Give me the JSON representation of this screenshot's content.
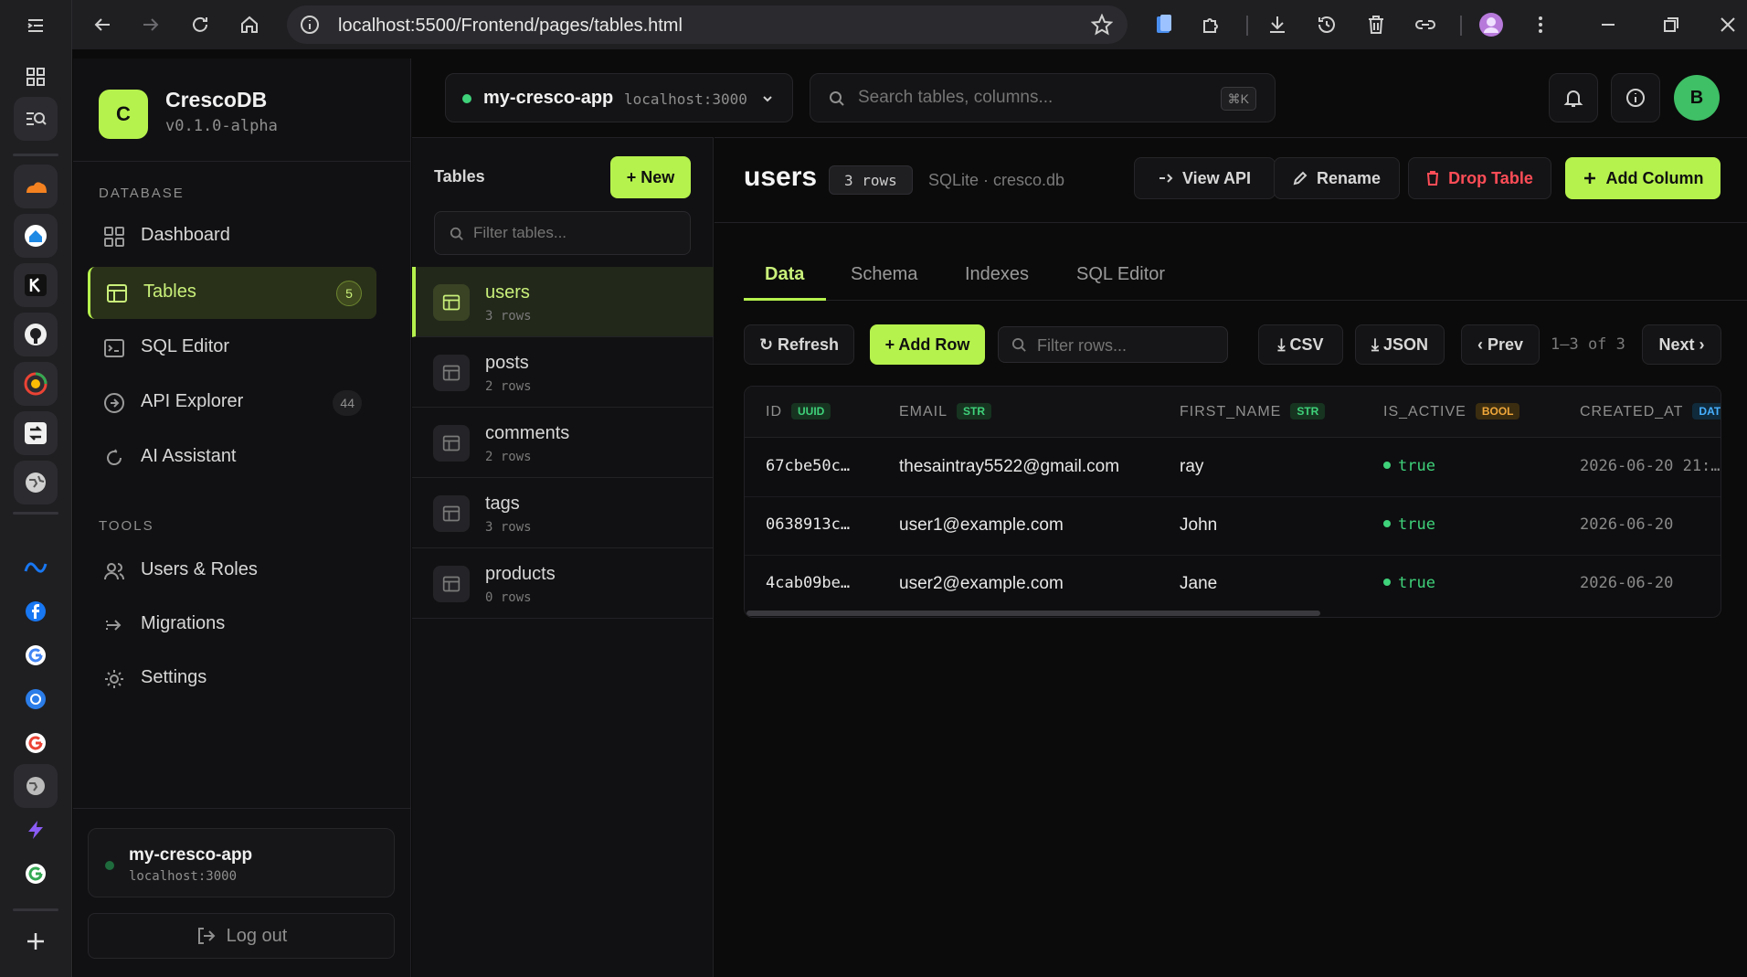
{
  "browser": {
    "url": "localhost:5500/Frontend/pages/tables.html"
  },
  "brand": {
    "logo_letter": "C",
    "name": "CrescoDB",
    "version": "v0.1.0-alpha"
  },
  "sidebar": {
    "database_section": "DATABASE",
    "tools_section": "TOOLS",
    "database_items": [
      {
        "label": "Dashboard",
        "icon": "dashboard-icon"
      },
      {
        "label": "Tables",
        "icon": "table-icon",
        "badge": "5"
      },
      {
        "label": "SQL Editor",
        "icon": "terminal-icon"
      },
      {
        "label": "API Explorer",
        "icon": "api-icon",
        "badge": "44"
      },
      {
        "label": "AI Assistant",
        "icon": "ai-icon"
      }
    ],
    "tools_items": [
      {
        "label": "Users & Roles",
        "icon": "users-icon"
      },
      {
        "label": "Migrations",
        "icon": "migrations-icon"
      },
      {
        "label": "Settings",
        "icon": "settings-icon"
      }
    ],
    "connection": {
      "name": "my-cresco-app",
      "host": "localhost:3000"
    },
    "logout_label": "Log out"
  },
  "header": {
    "project_name": "my-cresco-app",
    "project_host": "localhost:3000",
    "search_placeholder": "Search tables, columns...",
    "search_shortcut": "⌘K",
    "avatar_letter": "B"
  },
  "tables_panel": {
    "title": "Tables",
    "new_label": "+ New",
    "filter_placeholder": "Filter tables...",
    "items": [
      {
        "name": "users",
        "rows": "3 rows"
      },
      {
        "name": "posts",
        "rows": "2 rows"
      },
      {
        "name": "comments",
        "rows": "2 rows"
      },
      {
        "name": "tags",
        "rows": "3 rows"
      },
      {
        "name": "products",
        "rows": "0 rows"
      }
    ]
  },
  "main": {
    "table_name": "users",
    "row_count": "3 rows",
    "db_info": "SQLite · cresco.db",
    "buttons": {
      "view_api": "View API",
      "rename": "Rename",
      "drop_table": "Drop Table",
      "add_column": "Add Column"
    },
    "tabs": [
      "Data",
      "Schema",
      "Indexes",
      "SQL Editor"
    ],
    "toolbar": {
      "refresh": "↻ Refresh",
      "add_row": "+ Add Row",
      "filter_placeholder": "Filter rows...",
      "csv": "⤓ CSV",
      "json": "⤓ JSON",
      "prev": "‹ Prev",
      "range": "1–3 of 3",
      "next": "Next ›"
    },
    "columns": [
      {
        "name": "ID",
        "type": "UUID"
      },
      {
        "name": "EMAIL",
        "type": "STR"
      },
      {
        "name": "FIRST_NAME",
        "type": "STR"
      },
      {
        "name": "IS_ACTIVE",
        "type": "BOOL"
      },
      {
        "name": "CREATED_AT",
        "type": "DAT"
      }
    ],
    "rows": [
      {
        "id": "67cbe50c…",
        "email": "thesaintray5522@gmail.com",
        "first_name": "ray",
        "is_active": "true",
        "created_at": "2026-06-20 21:…"
      },
      {
        "id": "0638913c…",
        "email": "user1@example.com",
        "first_name": "John",
        "is_active": "true",
        "created_at": "2026-06-20"
      },
      {
        "id": "4cab09be…",
        "email": "user2@example.com",
        "first_name": "Jane",
        "is_active": "true",
        "created_at": "2026-06-20"
      }
    ]
  },
  "colors": {
    "accent": "#b6f24d",
    "danger": "#ff4d57",
    "success": "#3fd27a",
    "background": "#0b0b0b"
  }
}
